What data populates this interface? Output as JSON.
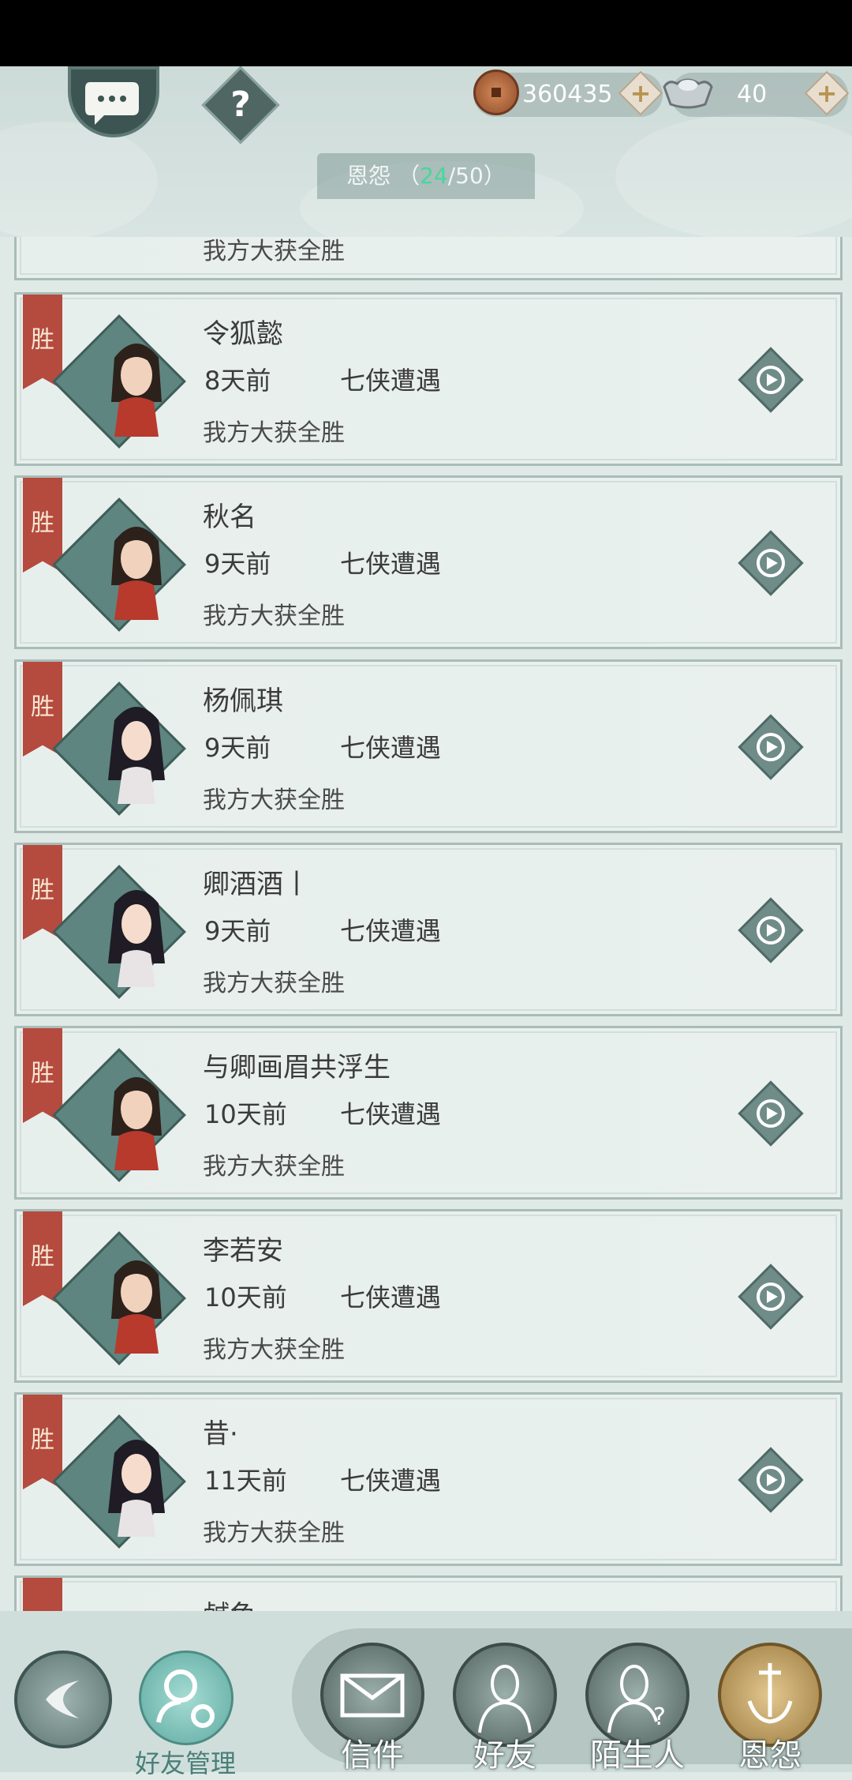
{
  "header": {
    "copper_value": "360435",
    "silver_value": "40",
    "title": "恩怨",
    "count_current": "24",
    "count_total": "50",
    "chat_icon": "chat-bubble-icon",
    "help_icon": "help-icon"
  },
  "partial_top": {
    "result": "我方大获全胜"
  },
  "records": [
    {
      "tag": "胜",
      "name": "令狐懿",
      "time": "8天前",
      "mode": "七侠遭遇",
      "result": "我方大获全胜",
      "avatar": "male"
    },
    {
      "tag": "胜",
      "name": "秋名",
      "time": "9天前",
      "mode": "七侠遭遇",
      "result": "我方大获全胜",
      "avatar": "male"
    },
    {
      "tag": "胜",
      "name": "杨佩琪",
      "time": "9天前",
      "mode": "七侠遭遇",
      "result": "我方大获全胜",
      "avatar": "female"
    },
    {
      "tag": "胜",
      "name": "卿酒酒丨",
      "time": "9天前",
      "mode": "七侠遭遇",
      "result": "我方大获全胜",
      "avatar": "female"
    },
    {
      "tag": "胜",
      "name": "与卿画眉共浮生",
      "time": "10天前",
      "mode": "七侠遭遇",
      "result": "我方大获全胜",
      "avatar": "male"
    },
    {
      "tag": "胜",
      "name": "李若安",
      "time": "10天前",
      "mode": "七侠遭遇",
      "result": "我方大获全胜",
      "avatar": "male"
    },
    {
      "tag": "胜",
      "name": "昔·",
      "time": "11天前",
      "mode": "七侠遭遇",
      "result": "我方大获全胜",
      "avatar": "female"
    }
  ],
  "partial_bottom": {
    "name": "鹹鱼"
  },
  "bottom": {
    "friend_manage": "好友管理",
    "tabs": [
      {
        "label": "信件",
        "icon": "envelope-icon"
      },
      {
        "label": "好友",
        "icon": "friend-icon"
      },
      {
        "label": "陌生人",
        "icon": "stranger-icon"
      },
      {
        "label": "恩怨",
        "icon": "grudge-icon"
      }
    ]
  }
}
